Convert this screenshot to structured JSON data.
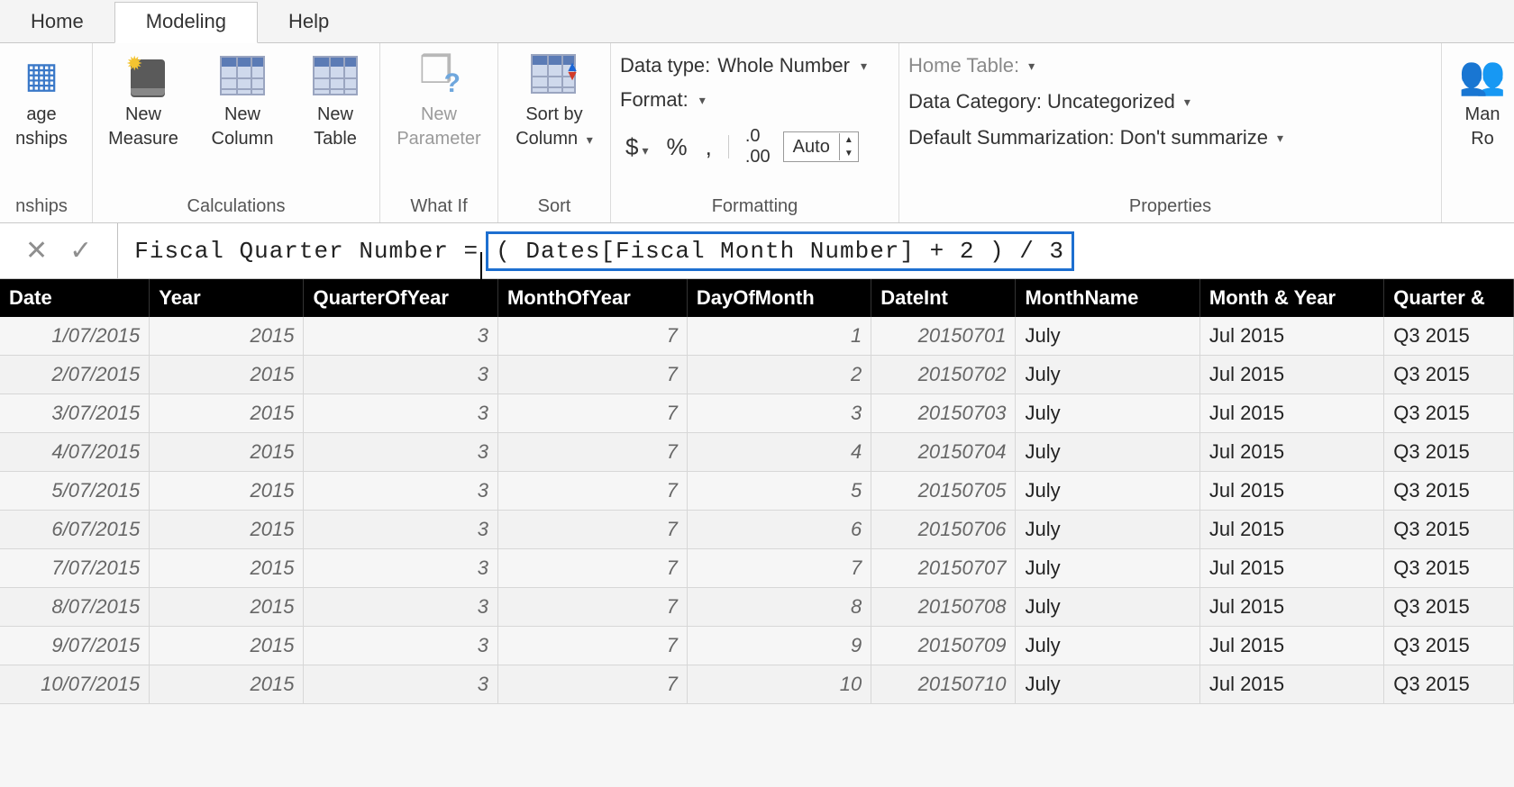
{
  "tabs": {
    "home": "Home",
    "modeling": "Modeling",
    "help": "Help",
    "active": "Modeling"
  },
  "ribbon": {
    "relationships": {
      "label": "nships",
      "btn1a": "age",
      "btn1b": "nships"
    },
    "calculations": {
      "label": "Calculations",
      "measure_a": "New",
      "measure_b": "Measure",
      "column_a": "New",
      "column_b": "Column",
      "table_a": "New",
      "table_b": "Table"
    },
    "whatif": {
      "label": "What If",
      "param_a": "New",
      "param_b": "Parameter"
    },
    "sort": {
      "label": "Sort",
      "sort_a": "Sort by",
      "sort_b": "Column"
    },
    "formatting": {
      "label": "Formatting",
      "datatype_label": "Data type:",
      "datatype_value": "Whole Number",
      "format_label": "Format:",
      "decimals": "Auto"
    },
    "properties": {
      "label": "Properties",
      "hometable_label": "Home Table:",
      "datacat_label": "Data Category:",
      "datacat_value": "Uncategorized",
      "summ_label": "Default Summarization:",
      "summ_value": "Don't summarize"
    },
    "security": {
      "roles_a": "Man",
      "roles_b": "Ro"
    }
  },
  "formula": {
    "left": "Fiscal Quarter Number =",
    "boxed": "( Dates[Fiscal Month Number] + 2 ) / 3"
  },
  "columns": [
    "Date",
    "Year",
    "QuarterOfYear",
    "MonthOfYear",
    "DayOfMonth",
    "DateInt",
    "MonthName",
    "Month & Year",
    "Quarter & "
  ],
  "rows": [
    {
      "date": "1/07/2015",
      "year": "2015",
      "qoy": "3",
      "moy": "7",
      "dom": "1",
      "dint": "20150701",
      "mname": "July",
      "my": "Jul 2015",
      "qy": "Q3 2015"
    },
    {
      "date": "2/07/2015",
      "year": "2015",
      "qoy": "3",
      "moy": "7",
      "dom": "2",
      "dint": "20150702",
      "mname": "July",
      "my": "Jul 2015",
      "qy": "Q3 2015"
    },
    {
      "date": "3/07/2015",
      "year": "2015",
      "qoy": "3",
      "moy": "7",
      "dom": "3",
      "dint": "20150703",
      "mname": "July",
      "my": "Jul 2015",
      "qy": "Q3 2015"
    },
    {
      "date": "4/07/2015",
      "year": "2015",
      "qoy": "3",
      "moy": "7",
      "dom": "4",
      "dint": "20150704",
      "mname": "July",
      "my": "Jul 2015",
      "qy": "Q3 2015"
    },
    {
      "date": "5/07/2015",
      "year": "2015",
      "qoy": "3",
      "moy": "7",
      "dom": "5",
      "dint": "20150705",
      "mname": "July",
      "my": "Jul 2015",
      "qy": "Q3 2015"
    },
    {
      "date": "6/07/2015",
      "year": "2015",
      "qoy": "3",
      "moy": "7",
      "dom": "6",
      "dint": "20150706",
      "mname": "July",
      "my": "Jul 2015",
      "qy": "Q3 2015"
    },
    {
      "date": "7/07/2015",
      "year": "2015",
      "qoy": "3",
      "moy": "7",
      "dom": "7",
      "dint": "20150707",
      "mname": "July",
      "my": "Jul 2015",
      "qy": "Q3 2015"
    },
    {
      "date": "8/07/2015",
      "year": "2015",
      "qoy": "3",
      "moy": "7",
      "dom": "8",
      "dint": "20150708",
      "mname": "July",
      "my": "Jul 2015",
      "qy": "Q3 2015"
    },
    {
      "date": "9/07/2015",
      "year": "2015",
      "qoy": "3",
      "moy": "7",
      "dom": "9",
      "dint": "20150709",
      "mname": "July",
      "my": "Jul 2015",
      "qy": "Q3 2015"
    },
    {
      "date": "10/07/2015",
      "year": "2015",
      "qoy": "3",
      "moy": "7",
      "dom": "10",
      "dint": "20150710",
      "mname": "July",
      "my": "Jul 2015",
      "qy": "Q3 2015"
    }
  ]
}
